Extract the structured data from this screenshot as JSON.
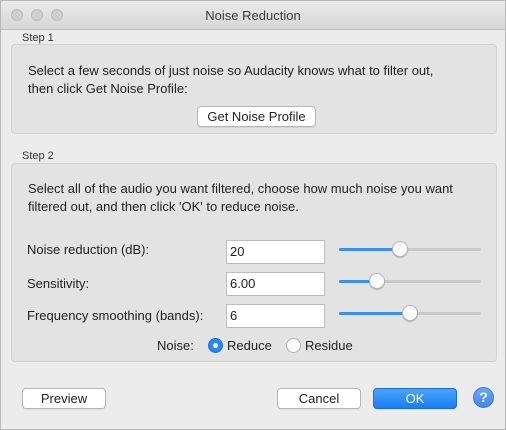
{
  "window": {
    "title": "Noise Reduction"
  },
  "step1": {
    "label": "Step 1",
    "line1": "Select a few seconds of just noise so Audacity knows what to filter out,",
    "line2": "then click Get Noise Profile:",
    "button": "Get Noise Profile"
  },
  "step2": {
    "label": "Step 2",
    "line1": "Select all of the audio you want filtered, choose how much noise you want",
    "line2": "filtered out, and then click 'OK' to reduce noise.",
    "fields": [
      {
        "label": "Noise reduction (dB):",
        "value": "20",
        "slider_fraction": 0.43
      },
      {
        "label": "Sensitivity:",
        "value": "6.00",
        "slider_fraction": 0.27
      },
      {
        "label": "Frequency smoothing (bands):",
        "value": "6",
        "slider_fraction": 0.5
      }
    ],
    "noise": {
      "label": "Noise:",
      "options": [
        {
          "label": "Reduce",
          "selected": true
        },
        {
          "label": "Residue",
          "selected": false
        }
      ]
    }
  },
  "buttons": {
    "preview": "Preview",
    "cancel": "Cancel",
    "ok": "OK",
    "help": "?"
  },
  "colors": {
    "accent": "#2b86f7",
    "window_bg": "#ececec",
    "group_bg": "#e3e3e3"
  },
  "icons": {
    "help": "question-mark-icon"
  }
}
